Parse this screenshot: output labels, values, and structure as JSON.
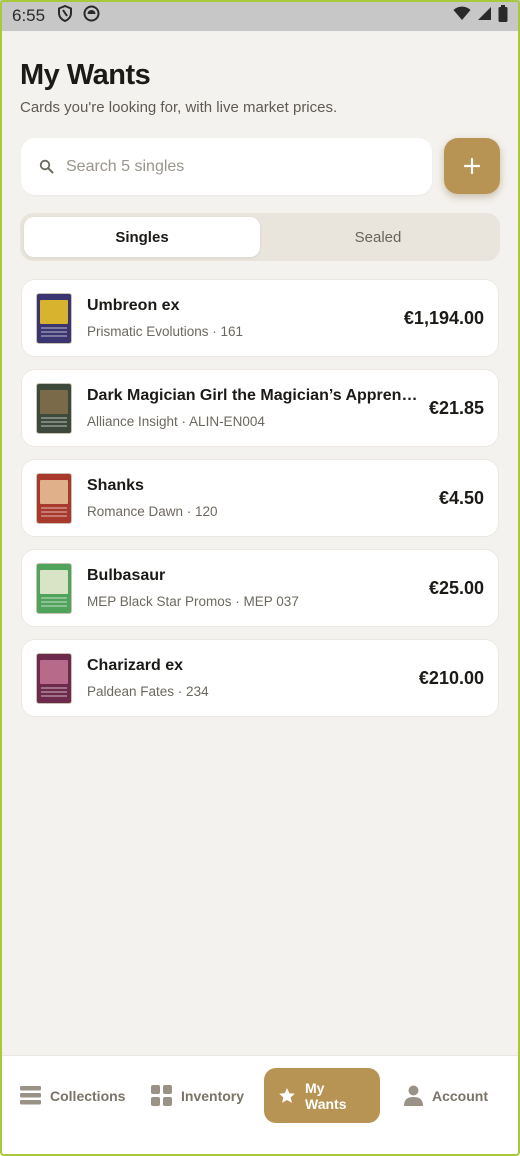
{
  "status_bar": {
    "time": "6:55"
  },
  "header": {
    "title": "My Wants",
    "subtitle": "Cards you're looking for, with live market prices."
  },
  "search": {
    "placeholder": "Search 5 singles"
  },
  "tabs": [
    {
      "label": "Singles",
      "active": true
    },
    {
      "label": "Sealed",
      "active": false
    }
  ],
  "cards": [
    {
      "name": "Umbreon ex",
      "set": "Prismatic Evolutions",
      "number": "161",
      "meta": "Prismatic Evolutions · 161",
      "price": "€1,194.00",
      "thumb_colors": [
        "#3a3470",
        "#d8b42e"
      ]
    },
    {
      "name": "Dark Magician Girl the Magician’s Apprentice",
      "set": "Alliance Insight",
      "number": "ALIN-EN004",
      "meta": "Alliance Insight · ALIN-EN004",
      "price": "€21.85",
      "thumb_colors": [
        "#3d4a3b",
        "#7b6a4a"
      ]
    },
    {
      "name": "Shanks",
      "set": "Romance Dawn",
      "number": "120",
      "meta": "Romance Dawn · 120",
      "price": "€4.50",
      "thumb_colors": [
        "#a8392c",
        "#e0b08a"
      ]
    },
    {
      "name": "Bulbasaur",
      "set": "MEP Black Star Promos",
      "number": "MEP 037",
      "meta": "MEP Black Star Promos · MEP 037",
      "price": "€25.00",
      "thumb_colors": [
        "#4fa35a",
        "#d9e3c6"
      ]
    },
    {
      "name": "Charizard ex",
      "set": "Paldean Fates",
      "number": "234",
      "meta": "Paldean Fates · 234",
      "price": "€210.00",
      "thumb_colors": [
        "#6d2a4a",
        "#b86a8a"
      ]
    }
  ],
  "bottom_nav": [
    {
      "label": "Collections",
      "icon": "collections-icon",
      "active": false
    },
    {
      "label": "Inventory",
      "icon": "inventory-grid-icon",
      "active": false
    },
    {
      "label": "My Wants",
      "icon": "star-icon",
      "active": true
    },
    {
      "label": "Account",
      "icon": "person-icon",
      "active": false
    }
  ],
  "colors": {
    "accent": "#b89454",
    "background": "#f4f2ee",
    "surface": "#ffffff",
    "muted_text": "#6d685f"
  }
}
